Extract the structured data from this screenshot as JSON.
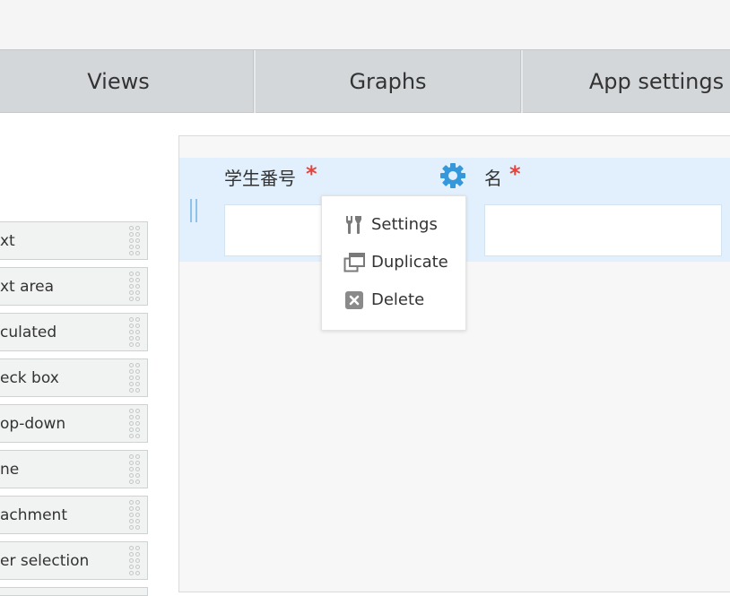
{
  "tabs": [
    {
      "label": "Views"
    },
    {
      "label": "Graphs"
    },
    {
      "label": "App settings"
    }
  ],
  "palette": {
    "items": [
      {
        "label": "xt"
      },
      {
        "label": "xt area"
      },
      {
        "label": "culated"
      },
      {
        "label": "eck box"
      },
      {
        "label": "op-down"
      },
      {
        "label": "ne"
      },
      {
        "label": "achment"
      },
      {
        "label": "er selection"
      }
    ]
  },
  "form": {
    "fields": [
      {
        "label": "学生番号",
        "required_mark": "*"
      },
      {
        "label": "名",
        "required_mark": "*"
      }
    ]
  },
  "field_menu": {
    "items": [
      {
        "label": "Settings",
        "icon": "wrench-screwdriver-icon"
      },
      {
        "label": "Duplicate",
        "icon": "duplicate-icon"
      },
      {
        "label": "Delete",
        "icon": "delete-icon"
      }
    ]
  },
  "colors": {
    "accent": "#3498db",
    "required": "#e2443c",
    "row_highlight": "#e1f0fc"
  }
}
